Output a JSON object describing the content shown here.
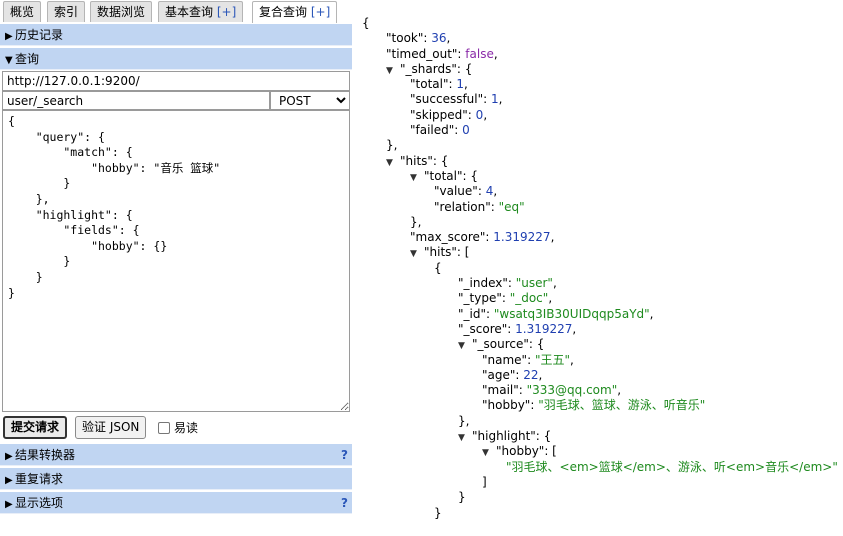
{
  "tabs": [
    {
      "label": "概览",
      "plus": ""
    },
    {
      "label": "索引",
      "plus": ""
    },
    {
      "label": "数据浏览",
      "plus": ""
    },
    {
      "label": "基本查询",
      "plus": "[+]"
    },
    {
      "label": "复合查询",
      "plus": "[+]"
    }
  ],
  "active_tab": 4,
  "sections": {
    "history": "历史记录",
    "query": "查询",
    "result_transformer": "结果转换器",
    "repeat_request": "重复请求",
    "display_options": "显示选项",
    "help_symbol": "?"
  },
  "request": {
    "url": "http://127.0.0.1:9200/",
    "path": "user/_search",
    "method": "POST",
    "body": "{\n    \"query\": {\n        \"match\": {\n            \"hobby\": \"音乐 篮球\"\n        }\n    },\n    \"highlight\": {\n        \"fields\": {\n            \"hobby\": {}\n        }\n    }\n}"
  },
  "buttons": {
    "submit": "提交请求",
    "validate": "验证 JSON",
    "pretty_label": "易读"
  },
  "response": {
    "open": "{",
    "took_key": "\"took\": ",
    "took": "36",
    "timed_out_key": "\"timed_out\": ",
    "timed_out": "false",
    "shards_key": "\"_shards\": {",
    "shards_total_key": "\"total\": ",
    "shards_total": "1",
    "shards_successful_key": "\"successful\": ",
    "shards_successful": "1",
    "shards_skipped_key": "\"skipped\": ",
    "shards_skipped": "0",
    "shards_failed_key": "\"failed\": ",
    "shards_failed": "0",
    "close_obj_comma": "},",
    "hits_key": "\"hits\": {",
    "total_key": "\"total\": {",
    "value_key": "\"value\": ",
    "value": "4",
    "relation_key": "\"relation\": ",
    "relation": "\"eq\"",
    "max_score_key": "\"max_score\": ",
    "max_score": "1.319227",
    "hits_arr_key": "\"hits\": [",
    "open_brace": "{",
    "index_key": "\"_index\": ",
    "index": "\"user\"",
    "type_key": "\"_type\": ",
    "type": "\"_doc\"",
    "id_key": "\"_id\": ",
    "id": "\"wsatq3IB30UIDqqp5aYd\"",
    "score_key": "\"_score\": ",
    "score": "1.319227",
    "source_key": "\"_source\": {",
    "name_key": "\"name\": ",
    "name": "\"王五\"",
    "age_key": "\"age\": ",
    "age": "22",
    "mail_key": "\"mail\": ",
    "mail": "\"333@qq.com\"",
    "hobby_key": "\"hobby\": ",
    "hobby": "\"羽毛球、篮球、游泳、听音乐\"",
    "highlight_key": "\"highlight\": {",
    "hl_hobby_key": "\"hobby\": [",
    "hl_hobby": "\"羽毛球、<em>篮球</em>、游泳、听<em>音乐</em>\"",
    "close_bracket": "]",
    "close_brace": "}",
    "comma": ","
  },
  "colors": {
    "section_bg": "#c0d5f2",
    "number": "#1f3fb0",
    "string": "#1e8a1e",
    "boolean": "#8a2aa8"
  }
}
